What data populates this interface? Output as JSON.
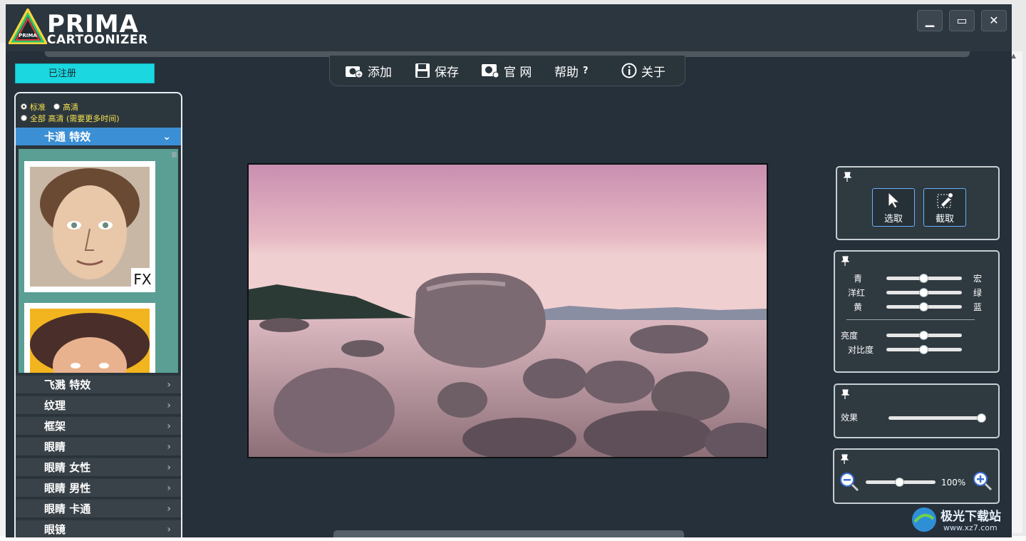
{
  "app": {
    "logo_line1": "PRIMA",
    "logo_line2": "CARTOONIZER",
    "logo_badge": "PRIMA"
  },
  "window_controls": {
    "minimize": "▁",
    "maximize": "▭",
    "close": "✕"
  },
  "toolbar": {
    "add": "添加",
    "save": "保存",
    "website": "官 网",
    "help": "帮助",
    "help_mark": "?",
    "about": "关于"
  },
  "registered": "已注册",
  "quality": {
    "standard": "标准",
    "hd": "高清",
    "all_hd": "全部 高清 (需要更多时间)"
  },
  "categories": {
    "active": "卡通 特效",
    "items": [
      "飞溅 特效",
      "纹理",
      "框架",
      "眼睛",
      "眼睛 女性",
      "眼睛 男性",
      "眼睛 卡通",
      "眼镜"
    ]
  },
  "thumbs": {
    "badge": "FX"
  },
  "tools": {
    "select": "选取",
    "crop": "截取"
  },
  "color_adjust": {
    "cyan": "青",
    "red": "宏",
    "magenta": "洋红",
    "green": "绿",
    "yellow": "黄",
    "blue": "蓝",
    "brightness": "亮度",
    "contrast": "对比度",
    "cyan_red_level": 0.5,
    "magenta_green_level": 0.5,
    "yellow_blue_level": 0.5,
    "brightness_level": 0.5,
    "contrast_level": 0.5
  },
  "effect": {
    "label": "效果",
    "level": 1.0
  },
  "zoom": {
    "value": "100%",
    "level": 0.45
  },
  "watermark": {
    "text": "极光下载站",
    "url": "www.xz7.com"
  },
  "colors": {
    "accent_cyan": "#1ad7e0",
    "panel_dark": "#26303a",
    "category_active": "#3b8fd4",
    "thumb_bg": "#5a9e94"
  }
}
